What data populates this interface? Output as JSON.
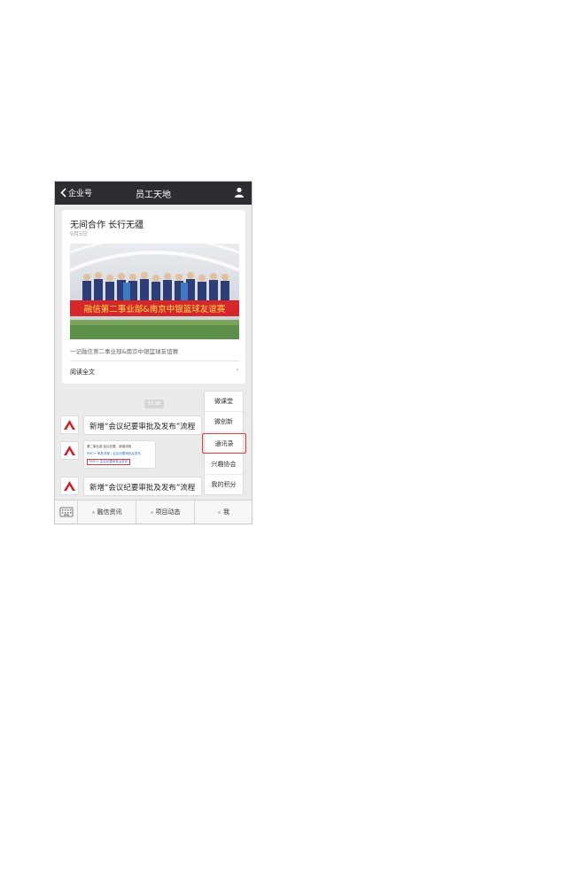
{
  "navbar": {
    "back_label": "企业号",
    "title": "员工天地"
  },
  "article": {
    "title": "无间合作 长行无疆",
    "date": "9月5日",
    "banner_text": "融信第二事业部&南京中银篮球友谊赛",
    "summary": "一记融信第二事业部&南京中银篮球友谊赛",
    "read_more": "阅读全文"
  },
  "chat": {
    "time": "11:38",
    "message1": "新增“会议纪要审批及发布”流程",
    "thumb_lines": [
      "第二事业部·会议纪要、新增流程",
      "PMO+ 审批流程 | 会议纪要审批及发布",
      "PMO+ 会议纪要审批及发布"
    ],
    "message2": "新增“会议纪要审批及发布”流程"
  },
  "popup_menu": {
    "items": [
      "微课堂",
      "微创新",
      "通讯录",
      "兴趣协会",
      "我的积分"
    ],
    "highlighted": "通讯录"
  },
  "tabbar": {
    "tabs": [
      "融信资讯",
      "项目动态",
      "我"
    ]
  },
  "colors": {
    "navbar_bg": "#2d2d31",
    "highlight": "#e23b3b",
    "chat_bg": "#ebebeb"
  }
}
